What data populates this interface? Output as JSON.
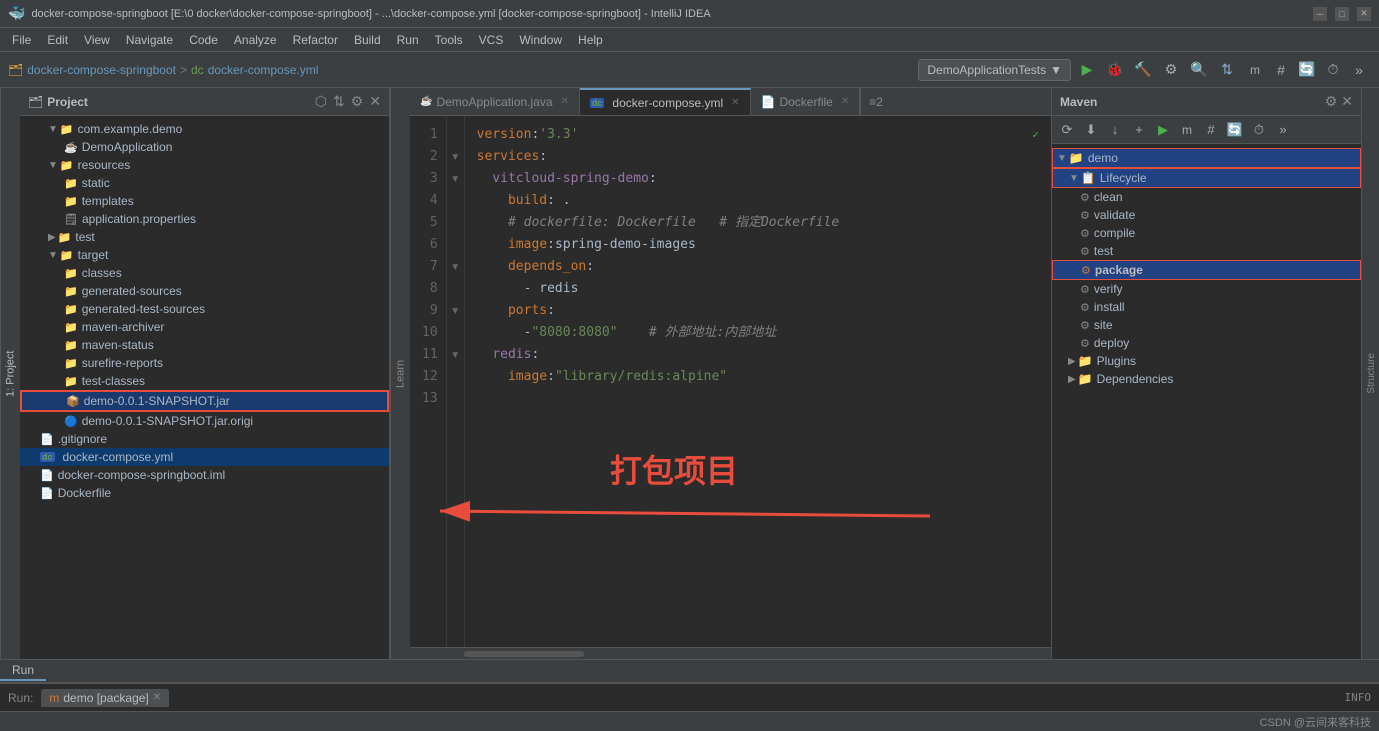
{
  "titleBar": {
    "title": "docker-compose-springboot [E:\\0 docker\\docker-compose-springboot] - ...\\docker-compose.yml [docker-compose-springboot] - IntelliJ IDEA",
    "appIcon": "🐳"
  },
  "menuBar": {
    "items": [
      "File",
      "Edit",
      "View",
      "Navigate",
      "Code",
      "Analyze",
      "Refactor",
      "Build",
      "Run",
      "Tools",
      "VCS",
      "Window",
      "Help"
    ]
  },
  "toolbar": {
    "breadcrumb": [
      "docker-compose-springboot",
      ">",
      "docker-compose.yml"
    ],
    "runConfig": "DemoApplicationTests",
    "buttons": [
      "▶",
      "🐞",
      "⚙",
      "🔨",
      "⟳",
      "⏹"
    ]
  },
  "projectPanel": {
    "title": "Project",
    "tree": [
      {
        "indent": 1,
        "type": "folder",
        "name": "com.example.demo",
        "expanded": true
      },
      {
        "indent": 2,
        "type": "java",
        "name": "DemoApplication"
      },
      {
        "indent": 1,
        "type": "folder",
        "name": "resources",
        "expanded": true
      },
      {
        "indent": 2,
        "type": "folder",
        "name": "static"
      },
      {
        "indent": 2,
        "type": "folder",
        "name": "templates"
      },
      {
        "indent": 2,
        "type": "props",
        "name": "application.properties"
      },
      {
        "indent": 1,
        "type": "folder",
        "name": "test",
        "collapsed": true
      },
      {
        "indent": 1,
        "type": "folder",
        "name": "target",
        "expanded": true
      },
      {
        "indent": 2,
        "type": "folder",
        "name": "classes"
      },
      {
        "indent": 2,
        "type": "folder",
        "name": "generated-sources"
      },
      {
        "indent": 2,
        "type": "folder",
        "name": "generated-test-sources"
      },
      {
        "indent": 2,
        "type": "folder",
        "name": "maven-archiver"
      },
      {
        "indent": 2,
        "type": "folder",
        "name": "maven-status"
      },
      {
        "indent": 2,
        "type": "folder",
        "name": "surefire-reports"
      },
      {
        "indent": 2,
        "type": "folder",
        "name": "test-classes"
      },
      {
        "indent": 2,
        "type": "jar",
        "name": "demo-0.0.1-SNAPSHOT.jar",
        "highlighted": true
      },
      {
        "indent": 2,
        "type": "file",
        "name": "demo-0.0.1-SNAPSHOT.jar.origi"
      },
      {
        "indent": 0,
        "type": "file",
        "name": ".gitignore"
      },
      {
        "indent": 0,
        "type": "yaml",
        "name": "docker-compose.yml",
        "selected": true
      },
      {
        "indent": 0,
        "type": "xml",
        "name": "docker-compose-springboot.iml"
      },
      {
        "indent": 0,
        "type": "file",
        "name": "Dockerfile"
      }
    ]
  },
  "tabs": [
    {
      "label": "DemoApplication.java",
      "type": "java",
      "active": false
    },
    {
      "label": "docker-compose.yml",
      "type": "yaml",
      "active": true
    },
    {
      "label": "Dockerfile",
      "type": "file",
      "active": false
    }
  ],
  "editor": {
    "lines": [
      {
        "num": 1,
        "content": "version: '3.3'"
      },
      {
        "num": 2,
        "content": "services:"
      },
      {
        "num": 3,
        "content": "  vitcloud-spring-demo:"
      },
      {
        "num": 4,
        "content": "    build: ."
      },
      {
        "num": 5,
        "content": "    # dockerfile: Dockerfile  # 指定Dockerfile"
      },
      {
        "num": 6,
        "content": "    image: spring-demo-images"
      },
      {
        "num": 7,
        "content": "    depends_on:"
      },
      {
        "num": 8,
        "content": "      - redis"
      },
      {
        "num": 9,
        "content": "    ports:"
      },
      {
        "num": 10,
        "content": "      - \"8080:8080\"    # 外部地址:内部地址"
      },
      {
        "num": 11,
        "content": "  redis:"
      },
      {
        "num": 12,
        "content": "    image:\"library/redis:alpine\""
      },
      {
        "num": 13,
        "content": ""
      }
    ]
  },
  "mavenPanel": {
    "title": "Maven",
    "tree": [
      {
        "indent": 0,
        "type": "folder",
        "name": "demo",
        "expanded": true,
        "highlighted": true
      },
      {
        "indent": 1,
        "type": "folder",
        "name": "Lifecycle",
        "expanded": true,
        "highlighted": true
      },
      {
        "indent": 2,
        "type": "gear",
        "name": "clean"
      },
      {
        "indent": 2,
        "type": "gear",
        "name": "validate"
      },
      {
        "indent": 2,
        "type": "gear",
        "name": "compile"
      },
      {
        "indent": 2,
        "type": "gear",
        "name": "test"
      },
      {
        "indent": 2,
        "type": "gear",
        "name": "package",
        "selected": true,
        "highlighted": true
      },
      {
        "indent": 2,
        "type": "gear",
        "name": "verify"
      },
      {
        "indent": 2,
        "type": "gear",
        "name": "install"
      },
      {
        "indent": 2,
        "type": "gear",
        "name": "site"
      },
      {
        "indent": 2,
        "type": "gear",
        "name": "deploy"
      },
      {
        "indent": 1,
        "type": "folder",
        "name": "Plugins",
        "collapsed": true
      },
      {
        "indent": 1,
        "type": "folder",
        "name": "Dependencies",
        "collapsed": true
      }
    ]
  },
  "bottomTabs": [
    "Run"
  ],
  "runBar": {
    "label": "Run:",
    "tab": "demo [package]"
  },
  "statusBar": {
    "right": "CSDN @云间来客科技"
  },
  "annotation": {
    "text": "打包项目",
    "arrowFrom": "jar file to package goal"
  }
}
